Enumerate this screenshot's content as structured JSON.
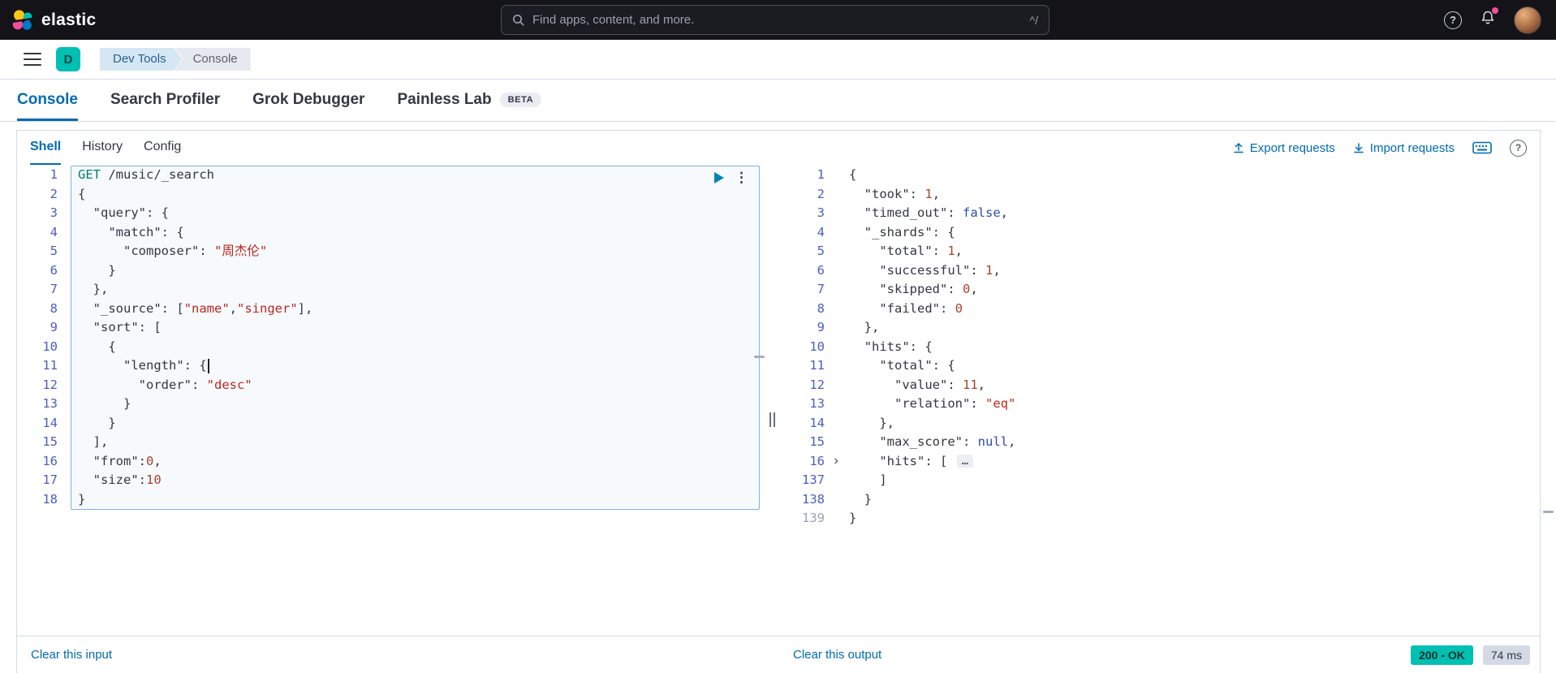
{
  "header": {
    "brand": "elastic",
    "search": {
      "placeholder": "Find apps, content, and more.",
      "shortcut_hint": "^/"
    }
  },
  "nav": {
    "space_initial": "D",
    "breadcrumbs": [
      "Dev Tools",
      "Console"
    ]
  },
  "tabs": [
    {
      "label": "Console",
      "active": true
    },
    {
      "label": "Search Profiler",
      "active": false
    },
    {
      "label": "Grok Debugger",
      "active": false
    },
    {
      "label": "Painless Lab",
      "active": false,
      "badge": "BETA"
    }
  ],
  "console": {
    "subtabs": [
      {
        "label": "Shell",
        "active": true
      },
      {
        "label": "History",
        "active": false
      },
      {
        "label": "Config",
        "active": false
      }
    ],
    "toolbar": {
      "export_label": "Export requests",
      "import_label": "Import requests"
    },
    "request_editor": {
      "gutter": [
        "1",
        "2",
        "3",
        "4",
        "5",
        "6",
        "7",
        "8",
        "9",
        "10",
        "11",
        "12",
        "13",
        "14",
        "15",
        "16",
        "17",
        "18"
      ],
      "lines": [
        [
          {
            "t": "GET",
            "c": "m"
          },
          {
            "t": " /music/_search",
            "c": "u"
          }
        ],
        [
          {
            "t": "{",
            "c": "p"
          }
        ],
        [
          {
            "t": "  ",
            "c": "p"
          },
          {
            "t": "\"query\"",
            "c": "k"
          },
          {
            "t": ": {",
            "c": "p"
          }
        ],
        [
          {
            "t": "    ",
            "c": "p"
          },
          {
            "t": "\"match\"",
            "c": "k"
          },
          {
            "t": ": {",
            "c": "p"
          }
        ],
        [
          {
            "t": "      ",
            "c": "p"
          },
          {
            "t": "\"composer\"",
            "c": "k"
          },
          {
            "t": ": ",
            "c": "p"
          },
          {
            "t": "\"周杰伦\"",
            "c": "s"
          }
        ],
        [
          {
            "t": "    }",
            "c": "p"
          }
        ],
        [
          {
            "t": "  },",
            "c": "p"
          }
        ],
        [
          {
            "t": "  ",
            "c": "p"
          },
          {
            "t": "\"_source\"",
            "c": "k"
          },
          {
            "t": ": [",
            "c": "p"
          },
          {
            "t": "\"name\"",
            "c": "s"
          },
          {
            "t": ",",
            "c": "p"
          },
          {
            "t": "\"singer\"",
            "c": "s"
          },
          {
            "t": "],",
            "c": "p"
          }
        ],
        [
          {
            "t": "  ",
            "c": "p"
          },
          {
            "t": "\"sort\"",
            "c": "k"
          },
          {
            "t": ": [",
            "c": "p"
          }
        ],
        [
          {
            "t": "    {",
            "c": "p"
          }
        ],
        [
          {
            "t": "      ",
            "c": "p"
          },
          {
            "t": "\"length\"",
            "c": "k"
          },
          {
            "t": ": {",
            "c": "p"
          },
          {
            "t": "",
            "c": "cursor"
          }
        ],
        [
          {
            "t": "        ",
            "c": "p"
          },
          {
            "t": "\"order\"",
            "c": "k"
          },
          {
            "t": ": ",
            "c": "p"
          },
          {
            "t": "\"desc\"",
            "c": "s"
          }
        ],
        [
          {
            "t": "      }",
            "c": "p"
          }
        ],
        [
          {
            "t": "    }",
            "c": "p"
          }
        ],
        [
          {
            "t": "  ],",
            "c": "p"
          }
        ],
        [
          {
            "t": "  ",
            "c": "p"
          },
          {
            "t": "\"from\"",
            "c": "k"
          },
          {
            "t": ":",
            "c": "p"
          },
          {
            "t": "0",
            "c": "n"
          },
          {
            "t": ",",
            "c": "p"
          }
        ],
        [
          {
            "t": "  ",
            "c": "p"
          },
          {
            "t": "\"size\"",
            "c": "k"
          },
          {
            "t": ":",
            "c": "p"
          },
          {
            "t": "10",
            "c": "n"
          }
        ],
        [
          {
            "t": "}",
            "c": "p"
          }
        ]
      ]
    },
    "response_viewer": {
      "gutter": [
        {
          "n": "1"
        },
        {
          "n": "2"
        },
        {
          "n": "3"
        },
        {
          "n": "4"
        },
        {
          "n": "5"
        },
        {
          "n": "6"
        },
        {
          "n": "7"
        },
        {
          "n": "8"
        },
        {
          "n": "9"
        },
        {
          "n": "10"
        },
        {
          "n": "11"
        },
        {
          "n": "12"
        },
        {
          "n": "13"
        },
        {
          "n": "14"
        },
        {
          "n": "15"
        },
        {
          "n": "16",
          "fold": true
        },
        {
          "n": "137"
        },
        {
          "n": "138"
        },
        {
          "n": "139",
          "muted": true
        }
      ],
      "lines": [
        [
          {
            "t": "{",
            "c": "p"
          }
        ],
        [
          {
            "t": "  ",
            "c": "p"
          },
          {
            "t": "\"took\"",
            "c": "k"
          },
          {
            "t": ": ",
            "c": "p"
          },
          {
            "t": "1",
            "c": "n"
          },
          {
            "t": ",",
            "c": "p"
          }
        ],
        [
          {
            "t": "  ",
            "c": "p"
          },
          {
            "t": "\"timed_out\"",
            "c": "k"
          },
          {
            "t": ": ",
            "c": "p"
          },
          {
            "t": "false",
            "c": "b"
          },
          {
            "t": ",",
            "c": "p"
          }
        ],
        [
          {
            "t": "  ",
            "c": "p"
          },
          {
            "t": "\"_shards\"",
            "c": "k"
          },
          {
            "t": ": {",
            "c": "p"
          }
        ],
        [
          {
            "t": "    ",
            "c": "p"
          },
          {
            "t": "\"total\"",
            "c": "k"
          },
          {
            "t": ": ",
            "c": "p"
          },
          {
            "t": "1",
            "c": "n"
          },
          {
            "t": ",",
            "c": "p"
          }
        ],
        [
          {
            "t": "    ",
            "c": "p"
          },
          {
            "t": "\"successful\"",
            "c": "k"
          },
          {
            "t": ": ",
            "c": "p"
          },
          {
            "t": "1",
            "c": "n"
          },
          {
            "t": ",",
            "c": "p"
          }
        ],
        [
          {
            "t": "    ",
            "c": "p"
          },
          {
            "t": "\"skipped\"",
            "c": "k"
          },
          {
            "t": ": ",
            "c": "p"
          },
          {
            "t": "0",
            "c": "n"
          },
          {
            "t": ",",
            "c": "p"
          }
        ],
        [
          {
            "t": "    ",
            "c": "p"
          },
          {
            "t": "\"failed\"",
            "c": "k"
          },
          {
            "t": ": ",
            "c": "p"
          },
          {
            "t": "0",
            "c": "n"
          }
        ],
        [
          {
            "t": "  },",
            "c": "p"
          }
        ],
        [
          {
            "t": "  ",
            "c": "p"
          },
          {
            "t": "\"hits\"",
            "c": "k"
          },
          {
            "t": ": {",
            "c": "p"
          }
        ],
        [
          {
            "t": "    ",
            "c": "p"
          },
          {
            "t": "\"total\"",
            "c": "k"
          },
          {
            "t": ": {",
            "c": "p"
          }
        ],
        [
          {
            "t": "      ",
            "c": "p"
          },
          {
            "t": "\"value\"",
            "c": "k"
          },
          {
            "t": ": ",
            "c": "p"
          },
          {
            "t": "11",
            "c": "n"
          },
          {
            "t": ",",
            "c": "p"
          }
        ],
        [
          {
            "t": "      ",
            "c": "p"
          },
          {
            "t": "\"relation\"",
            "c": "k"
          },
          {
            "t": ": ",
            "c": "p"
          },
          {
            "t": "\"eq\"",
            "c": "s"
          }
        ],
        [
          {
            "t": "    },",
            "c": "p"
          }
        ],
        [
          {
            "t": "    ",
            "c": "p"
          },
          {
            "t": "\"max_score\"",
            "c": "k"
          },
          {
            "t": ": ",
            "c": "p"
          },
          {
            "t": "null",
            "c": "b"
          },
          {
            "t": ",",
            "c": "p"
          }
        ],
        [
          {
            "t": "    ",
            "c": "p"
          },
          {
            "t": "\"hits\"",
            "c": "k"
          },
          {
            "t": ": [ ",
            "c": "p"
          },
          {
            "t": "…",
            "c": "fold"
          }
        ],
        [
          {
            "t": "    ]",
            "c": "p"
          }
        ],
        [
          {
            "t": "  }",
            "c": "p"
          }
        ],
        [
          {
            "t": "}",
            "c": "p"
          }
        ]
      ]
    },
    "statusbar": {
      "clear_input": "Clear this input",
      "clear_output": "Clear this output",
      "status_badge": "200 - OK",
      "time_badge": "74 ms"
    },
    "colors": {
      "accent": "#006BB4",
      "status_badge_bg": "#00BFB3",
      "time_badge_bg": "#D3DAE6",
      "alert_dot": "#F04E98"
    }
  }
}
